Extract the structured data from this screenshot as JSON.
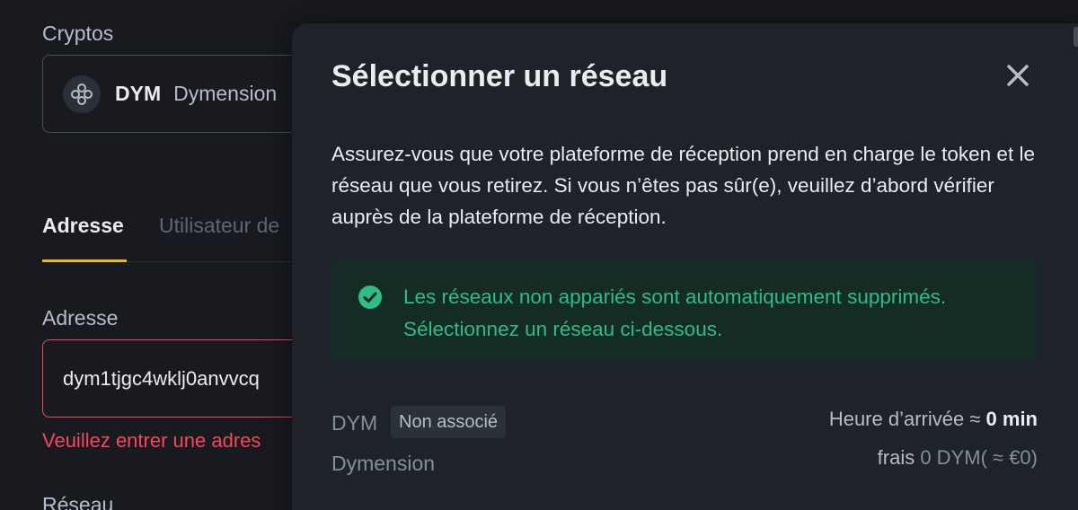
{
  "background": {
    "crypto_label": "Cryptos",
    "crypto": {
      "symbol": "DYM",
      "name": "Dymension",
      "icon": "dymension-logo-icon"
    },
    "tabs": [
      {
        "label": "Adresse",
        "active": true
      },
      {
        "label": "Utilisateur de"
      }
    ],
    "address_label": "Adresse",
    "address_value": "dym1tjgc4wklj0anvvcq",
    "address_error": "Veuillez entrer une adres",
    "network_label": "Réseau"
  },
  "modal": {
    "title": "Sélectionner un réseau",
    "close_icon": "close-icon",
    "description": "Assurez-vous que votre plateforme de réception prend en charge le token et le réseau que vous retirez. Si vous n’êtes pas sûr(e), veuillez d’abord vérifier auprès de la plateforme de réception.",
    "notice": {
      "icon": "check-circle-icon",
      "line1": "Les réseaux non appariés sont automatiquement supprimés.",
      "line2": "Sélectionnez un réseau ci-dessous.",
      "color": "#2ebd85"
    },
    "networks": [
      {
        "symbol": "DYM",
        "badge": "Non associé",
        "name": "Dymension",
        "arrival_label": "Heure d’arrivée ≈ ",
        "arrival_value": "0 min",
        "fee_label": "frais ",
        "fee_value": "0 DYM( ≈ €0)"
      }
    ]
  },
  "colors": {
    "accent": "#f0b90b",
    "error": "#f6465d",
    "success": "#2ebd85"
  }
}
